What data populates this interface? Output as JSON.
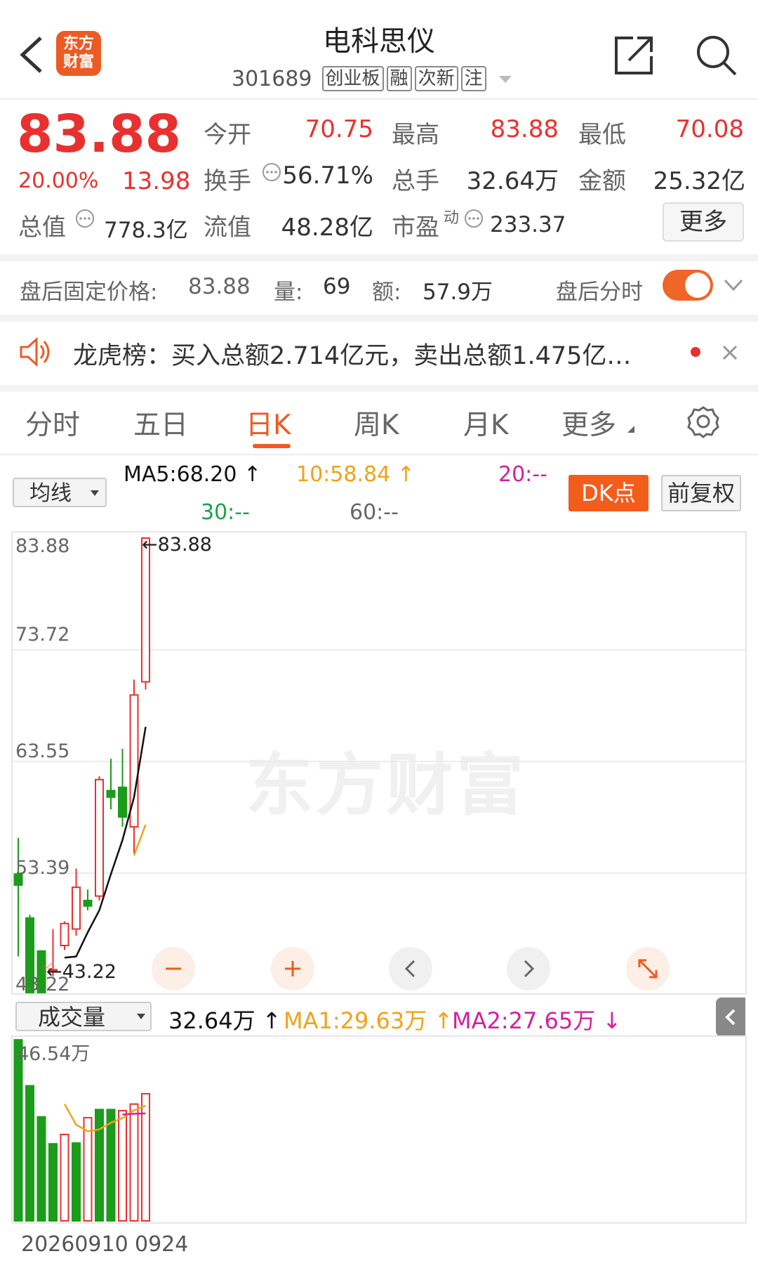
{
  "header": {
    "stock_name": "电科思仪",
    "stock_code": "301689",
    "tags": [
      "创业板",
      "融",
      "次新",
      "注"
    ],
    "logo_line1": "东方",
    "logo_line2": "财富"
  },
  "quote": {
    "price": "83.88",
    "change_pct": "20.00%",
    "change": "13.98",
    "fields": {
      "open_label": "今开",
      "open": "70.75",
      "high_label": "最高",
      "high": "83.88",
      "low_label": "最低",
      "low": "70.08",
      "turnover_label": "换手",
      "turnover": "56.71%",
      "volume_label": "总手",
      "volume": "32.64万",
      "amount_label": "金额",
      "amount": "25.32亿",
      "mcap_label": "总值",
      "mcap": "778.3亿",
      "float_label": "流值",
      "float": "48.28亿",
      "pe_label": "市盈",
      "pe_sup": "动",
      "pe": "233.37"
    },
    "more_label": "更多"
  },
  "after_hours": {
    "price_label": "盘后固定价格:",
    "price": "83.88",
    "volume_label": "量:",
    "volume": "69",
    "amount_label": "额:",
    "amount": "57.9万",
    "timeshare_label": "盘后分时",
    "toggle_on": true
  },
  "notice": {
    "text": "龙虎榜：买入总额2.714亿元，卖出总额1.475亿…"
  },
  "tabs": [
    "分时",
    "五日",
    "日K",
    "周K",
    "月K",
    "更多"
  ],
  "active_tab": "日K",
  "ma_row": {
    "select": "均线",
    "ma5": "MA5:68.20",
    "ma10": "10:58.84",
    "ma20": "20:--",
    "ma30": "30:--",
    "ma60": "60:--",
    "dk_label": "DK点",
    "adjust_label": "前复权"
  },
  "colors": {
    "up": "#e8312f",
    "down": "#1b9c1b",
    "accent": "#ec5b24",
    "ma5": "#111111",
    "ma10": "#f0a318",
    "ma20": "#d61f9c"
  },
  "chart_data": {
    "type": "candlestick",
    "y_ticks": [
      "83.88",
      "73.72",
      "63.55",
      "53.39",
      "43.22"
    ],
    "ylim": [
      43.22,
      83.88
    ],
    "max_label": "83.88",
    "min_label": "43.22",
    "candles": [
      {
        "o": 53.3,
        "c": 52.3,
        "h": 56.6,
        "l": 45.8
      },
      {
        "o": 49.3,
        "c": 41.0,
        "h": 49.6,
        "l": 40.5
      },
      {
        "o": 46.3,
        "c": 41.5,
        "h": 46.3,
        "l": 40.6
      },
      {
        "o": 44.6,
        "c": 44.6,
        "h": 48.3,
        "l": 44.0
      },
      {
        "o": 46.8,
        "c": 48.8,
        "h": 49.0,
        "l": 46.4
      },
      {
        "o": 48.3,
        "c": 52.1,
        "h": 53.8,
        "l": 47.7
      },
      {
        "o": 50.9,
        "c": 50.4,
        "h": 51.9,
        "l": 50.0
      },
      {
        "o": 51.3,
        "c": 61.9,
        "h": 62.2,
        "l": 50.9
      },
      {
        "o": 60.9,
        "c": 60.3,
        "h": 63.8,
        "l": 59.2
      },
      {
        "o": 61.2,
        "c": 58.5,
        "h": 64.7,
        "l": 57.6
      },
      {
        "o": 57.6,
        "c": 69.6,
        "h": 71.0,
        "l": 55.2
      },
      {
        "o": 70.8,
        "c": 83.88,
        "h": 83.88,
        "l": 70.1
      }
    ],
    "ma5_series": [
      null,
      null,
      null,
      null,
      45.7,
      45.8,
      48.0,
      50.0,
      53.3,
      56.4,
      60.3,
      66.7
    ],
    "ma10_series": [
      null,
      null,
      null,
      null,
      null,
      null,
      null,
      null,
      null,
      null,
      55.0,
      57.8
    ]
  },
  "volume": {
    "select": "成交量",
    "current": "32.64万",
    "ma1": "MA1:29.63万",
    "ma2": "MA2:27.65万",
    "max_label": "46.54万",
    "ylim": [
      0,
      46.54
    ],
    "bars": [
      {
        "v": 46.5,
        "up": false
      },
      {
        "v": 34.7,
        "up": false
      },
      {
        "v": 26.7,
        "up": false
      },
      {
        "v": 19.8,
        "up": false
      },
      {
        "v": 22.2,
        "up": true
      },
      {
        "v": 20.0,
        "up": false
      },
      {
        "v": 26.5,
        "up": true
      },
      {
        "v": 28.6,
        "up": false
      },
      {
        "v": 28.6,
        "up": false
      },
      {
        "v": 28.3,
        "up": true
      },
      {
        "v": 30.0,
        "up": true
      },
      {
        "v": 32.64,
        "up": true
      }
    ],
    "ma1_series": [
      null,
      null,
      null,
      null,
      30.0,
      24.7,
      23.0,
      23.5,
      25.2,
      26.4,
      28.4,
      29.6
    ],
    "ma2_series": [
      null,
      null,
      null,
      null,
      null,
      null,
      null,
      null,
      null,
      27.3,
      27.5,
      27.6
    ]
  },
  "date_label": "20260910",
  "date_label2": "0924"
}
